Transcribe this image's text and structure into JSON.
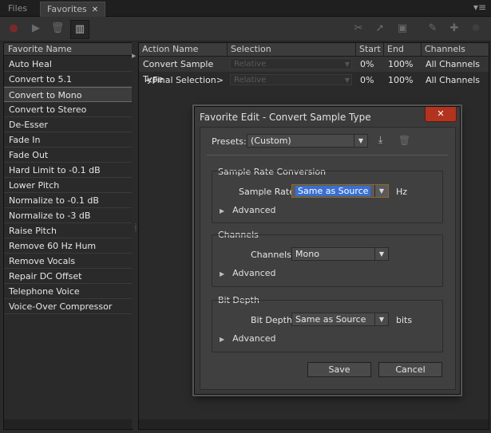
{
  "tabs": [
    {
      "label": "Files"
    },
    {
      "label": "Favorites",
      "close": "✕"
    }
  ],
  "panel_menu": "▾≡",
  "toolbar": {
    "icons": [
      "record-icon",
      "play-icon",
      "trash-icon",
      "columns-icon",
      "scissors-icon",
      "pointer-icon",
      "stamp-icon",
      "pencil-icon",
      "healing-icon",
      "lasso-icon"
    ]
  },
  "left": {
    "header": "Favorite Name",
    "items": [
      "Auto Heal",
      "Convert to 5.1",
      "Convert to Mono",
      "Convert to Stereo",
      "De-Esser",
      "Fade In",
      "Fade Out",
      "Hard Limit to -0.1 dB",
      "Lower Pitch",
      "Normalize to -0.1 dB",
      "Normalize to -3 dB",
      "Raise Pitch",
      "Remove 60 Hz Hum",
      "Remove Vocals",
      "Repair DC Offset",
      "Telephone Voice",
      "Voice-Over Compressor"
    ],
    "selected_index": 2
  },
  "table": {
    "headers": [
      "Action Name",
      "Selection",
      "Start",
      "End",
      "Channels"
    ],
    "rows": [
      {
        "action": "Convert Sample Type",
        "selection": "Relative",
        "start": "0%",
        "end": "100%",
        "channels": "All Channels"
      },
      {
        "action": "<Final Selection>",
        "selection": "Relative",
        "start": "0%",
        "end": "100%",
        "channels": "All Channels"
      }
    ]
  },
  "dialog": {
    "title": "Favorite Edit - Convert Sample Type",
    "close": "✕",
    "presets_label": "Presets:",
    "presets_value": "(Custom)",
    "src": {
      "title": "Sample Rate Conversion",
      "label": "Sample Rate:",
      "value": "Same as Source",
      "unit": "Hz",
      "advanced": "Advanced"
    },
    "ch": {
      "title": "Channels",
      "label": "Channels:",
      "value": "Mono",
      "advanced": "Advanced"
    },
    "bd": {
      "title": "Bit Depth",
      "label": "Bit Depth:",
      "value": "Same as Source",
      "unit": "bits",
      "advanced": "Advanced"
    },
    "save": "Save",
    "cancel": "Cancel"
  }
}
